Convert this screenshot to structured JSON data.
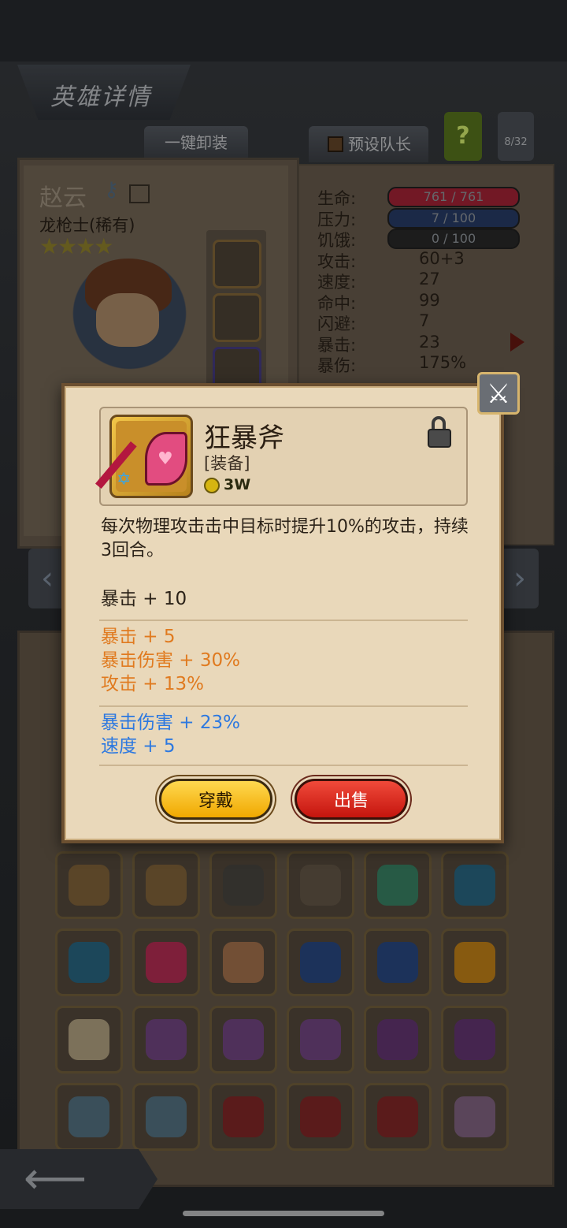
{
  "header": {
    "title": "英雄详情",
    "unequip_all": "一键卸装",
    "preset_leader": "预设队长",
    "help": "?",
    "page_counter": "8/32"
  },
  "hero": {
    "name": "赵云",
    "class_label": "龙枪士(稀有)",
    "stars": 4,
    "stars_text": "★★★★"
  },
  "stats": [
    {
      "label": "生命:",
      "value": "761 / 761",
      "kind": "bar",
      "color": "#b0263a"
    },
    {
      "label": "压力:",
      "value": "7 / 100",
      "kind": "bar",
      "color": "#2a3f6e"
    },
    {
      "label": "饥饿:",
      "value": "0 / 100",
      "kind": "bar",
      "color": "#2b2b2b"
    },
    {
      "label": "攻击:",
      "value": "60+3"
    },
    {
      "label": "速度:",
      "value": "27"
    },
    {
      "label": "命中:",
      "value": "99"
    },
    {
      "label": "闪避:",
      "value": "7"
    },
    {
      "label": "暴击:",
      "value": "23"
    },
    {
      "label": "暴伤:",
      "value": "175%"
    }
  ],
  "modal": {
    "item_name": "狂暴斧",
    "item_type": "[装备]",
    "price": "3W",
    "description": "每次物理攻击击中目标时提升10%的攻击，持续3回合。",
    "base_stats": [
      "暴击 + 10"
    ],
    "orange_stats": [
      "暴击 + 5",
      "暴击伤害 + 30%",
      "攻击 + 13%"
    ],
    "blue_stats": [
      "暴击伤害 + 23%",
      "速度 + 5"
    ],
    "wear_button": "穿戴",
    "sell_button": "出售",
    "close_icon": "crossed-swords-icon"
  },
  "inventory": {
    "rows": [
      [
        {
          "icon": "chest-icon",
          "color": "#8a6a3e"
        },
        {
          "icon": "chest-icon",
          "color": "#8a6a3e"
        },
        {
          "icon": "shield-icon",
          "color": "#4d4a44"
        },
        {
          "icon": "hood-icon",
          "color": "#6a5d4c"
        },
        {
          "icon": "ring-icon",
          "color": "#3c8a6a"
        },
        {
          "icon": "helmet-icon",
          "color": "#2c6d8a"
        }
      ],
      [
        {
          "icon": "helmet-icon",
          "color": "#2c6d8a"
        },
        {
          "icon": "axe-icon",
          "color": "#c2305a"
        },
        {
          "icon": "doll-icon",
          "color": "#b07a52"
        },
        {
          "icon": "helmet-icon",
          "color": "#2c4d8a"
        },
        {
          "icon": "helmet-icon",
          "color": "#2c4d8a"
        },
        {
          "icon": "ring-icon",
          "color": "#d08a1a"
        }
      ],
      [
        {
          "icon": "bone-icon",
          "color": "#bfae8a"
        },
        {
          "icon": "bag-icon",
          "color": "#7a4a8a"
        },
        {
          "icon": "bag-icon",
          "color": "#7a4a8a"
        },
        {
          "icon": "bag-icon",
          "color": "#7a4a8a"
        },
        {
          "icon": "wizard-hat-icon",
          "color": "#6a3a7a"
        },
        {
          "icon": "wizard-hat-icon",
          "color": "#6a3a7a"
        }
      ],
      [
        {
          "icon": "sword-icon",
          "color": "#5a7a8a"
        },
        {
          "icon": "sword-icon",
          "color": "#5a7a8a"
        },
        {
          "icon": "belt-icon",
          "color": "#8a2a2a"
        },
        {
          "icon": "belt-icon",
          "color": "#8a2a2a"
        },
        {
          "icon": "belt-icon",
          "color": "#8a2a2a"
        },
        {
          "icon": "claw-icon",
          "color": "#8a6a8a"
        }
      ]
    ]
  }
}
